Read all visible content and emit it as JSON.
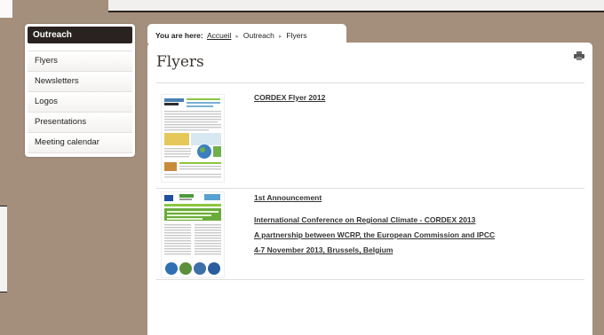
{
  "sidebar": {
    "header": "Outreach",
    "items": [
      {
        "label": "Flyers"
      },
      {
        "label": "Newsletters"
      },
      {
        "label": "Logos"
      },
      {
        "label": "Presentations"
      },
      {
        "label": "Meeting calendar"
      }
    ]
  },
  "breadcrumb": {
    "label": "You are here:",
    "items": [
      "Accueil",
      "Outreach",
      "Flyers"
    ]
  },
  "page": {
    "title": "Flyers",
    "flyers": [
      {
        "lines": [
          "CORDEX Flyer 2012"
        ]
      },
      {
        "lines": [
          "1st Announcement",
          "International Conference on Regional Climate - CORDEX 2013",
          "A partnership between WCRP, the European Commission and IPCC",
          "4-7 November 2013, Brussels, Belgium"
        ]
      }
    ]
  },
  "colors": {
    "background": "#a48f7c",
    "sidebar_header": "#2a2220",
    "accent_green": "#8cc63f"
  }
}
